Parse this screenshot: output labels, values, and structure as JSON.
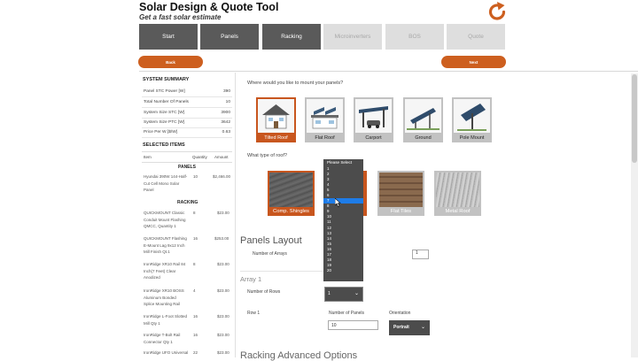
{
  "header": {
    "title": "Solar Design & Quote Tool",
    "subtitle": "Get a fast solar estimate",
    "refresh_icon": "refresh-icon"
  },
  "tabs": [
    {
      "label": "Start",
      "active": true
    },
    {
      "label": "Panels",
      "active": true
    },
    {
      "label": "Racking",
      "active": true
    },
    {
      "label": "Microinverters",
      "active": false
    },
    {
      "label": "BOS",
      "active": false
    },
    {
      "label": "Quote",
      "active": false
    }
  ],
  "nav": {
    "back_label": "Back",
    "next_label": "Next"
  },
  "colors": {
    "accent": "#cd5f1f",
    "tab_active": "#5a5a5a",
    "tab_inactive": "#dedede",
    "dropdown": "#4c4c4c",
    "highlight": "#1e7ce8"
  },
  "summary": {
    "heading": "SYSTEM SUMMARY",
    "rows": [
      {
        "label": "Panel STC Power [W]",
        "value": "390"
      },
      {
        "label": "Total Number Of Panels",
        "value": "10"
      },
      {
        "label": "System Size STC [W]",
        "value": "3900"
      },
      {
        "label": "System Size PTC [W]",
        "value": "3642"
      },
      {
        "label": "Price Per W [$/W]",
        "value": "0.63"
      }
    ]
  },
  "selected": {
    "heading": "SELECTED ITEMS",
    "columns": [
      "Item",
      "Quantity",
      "Amount"
    ],
    "group_panels": "PANELS",
    "group_racking": "RACKING",
    "panel_item": {
      "lines": [
        "Hyundai 390W 144-Half-",
        "Cut Cell Mono Solar",
        "Panel"
      ],
      "qty": "10",
      "amount": "$2,466.00"
    },
    "racking_items": [
      {
        "lines": [
          "QUICKMOUNT Classic",
          "Conduit Mount Flashing",
          "QMCC, Quantity 1"
        ],
        "qty": "8",
        "amount": "$23.00"
      },
      {
        "lines": [
          "QUICKMOUNT Flashing",
          "E-Mount Lag 9x12 Inch",
          "Mill Finish Qt.1"
        ],
        "qty": "16",
        "amount": "$253.00"
      },
      {
        "lines": [
          "IronRidge XR10 Rail 84",
          "Inch(7 Feet) Clear",
          "Anodized"
        ],
        "qty": "8",
        "amount": "$23.00"
      },
      {
        "lines": [
          "IronRidge XR10 BOSS",
          "Aluminum Bonded",
          "Splice Mounting Rail"
        ],
        "qty": "4",
        "amount": "$23.00"
      },
      {
        "lines": [
          "IronRidge L-Foot Slotted",
          "Mill Qty 1"
        ],
        "qty": "16",
        "amount": "$23.00"
      },
      {
        "lines": [
          "IronRidge T-Bolt Rail",
          "Connector Qty 1"
        ],
        "qty": "16",
        "amount": "$23.00"
      },
      {
        "lines": [
          "IronRidge UFO Universal"
        ],
        "qty": "22",
        "amount": "$23.00"
      }
    ]
  },
  "mount": {
    "question": "Where would you like to mount your panels?",
    "options": [
      {
        "label": "Tilted Roof",
        "icon": "tilted-roof-icon",
        "selected": true
      },
      {
        "label": "Flat Roof",
        "icon": "flat-roof-icon",
        "selected": false
      },
      {
        "label": "Carport",
        "icon": "carport-icon",
        "selected": false
      },
      {
        "label": "Ground",
        "icon": "ground-mount-icon",
        "selected": false
      },
      {
        "label": "Pole Mount",
        "icon": "pole-mount-icon",
        "selected": false
      }
    ]
  },
  "roof": {
    "question": "What type of roof?",
    "options": [
      {
        "label": "Comp. Shingles",
        "selected": true
      },
      {
        "label": "Flat Tiles",
        "selected": false
      },
      {
        "label": "Metal Roof",
        "selected": false
      }
    ]
  },
  "layout": {
    "heading": "Panels Layout",
    "arrays_label": "Number of Arrays",
    "arrays_value": "1",
    "array_heading": "Array 1",
    "rows_label": "Number of Rows",
    "rows_value": "1",
    "row_label": "Row 1",
    "panels_label": "Number of Panels",
    "panels_value": "10",
    "orientation_label": "Orientation",
    "orientation_value": "Portrait",
    "next_heading": "Racking Advanced Options"
  },
  "dropdown": {
    "placeholder": "Please Select",
    "options": [
      "1",
      "2",
      "3",
      "4",
      "5",
      "6",
      "7",
      "8",
      "9",
      "10",
      "11",
      "12",
      "13",
      "14",
      "15",
      "16",
      "17",
      "18",
      "19",
      "20"
    ],
    "highlighted": "7"
  }
}
